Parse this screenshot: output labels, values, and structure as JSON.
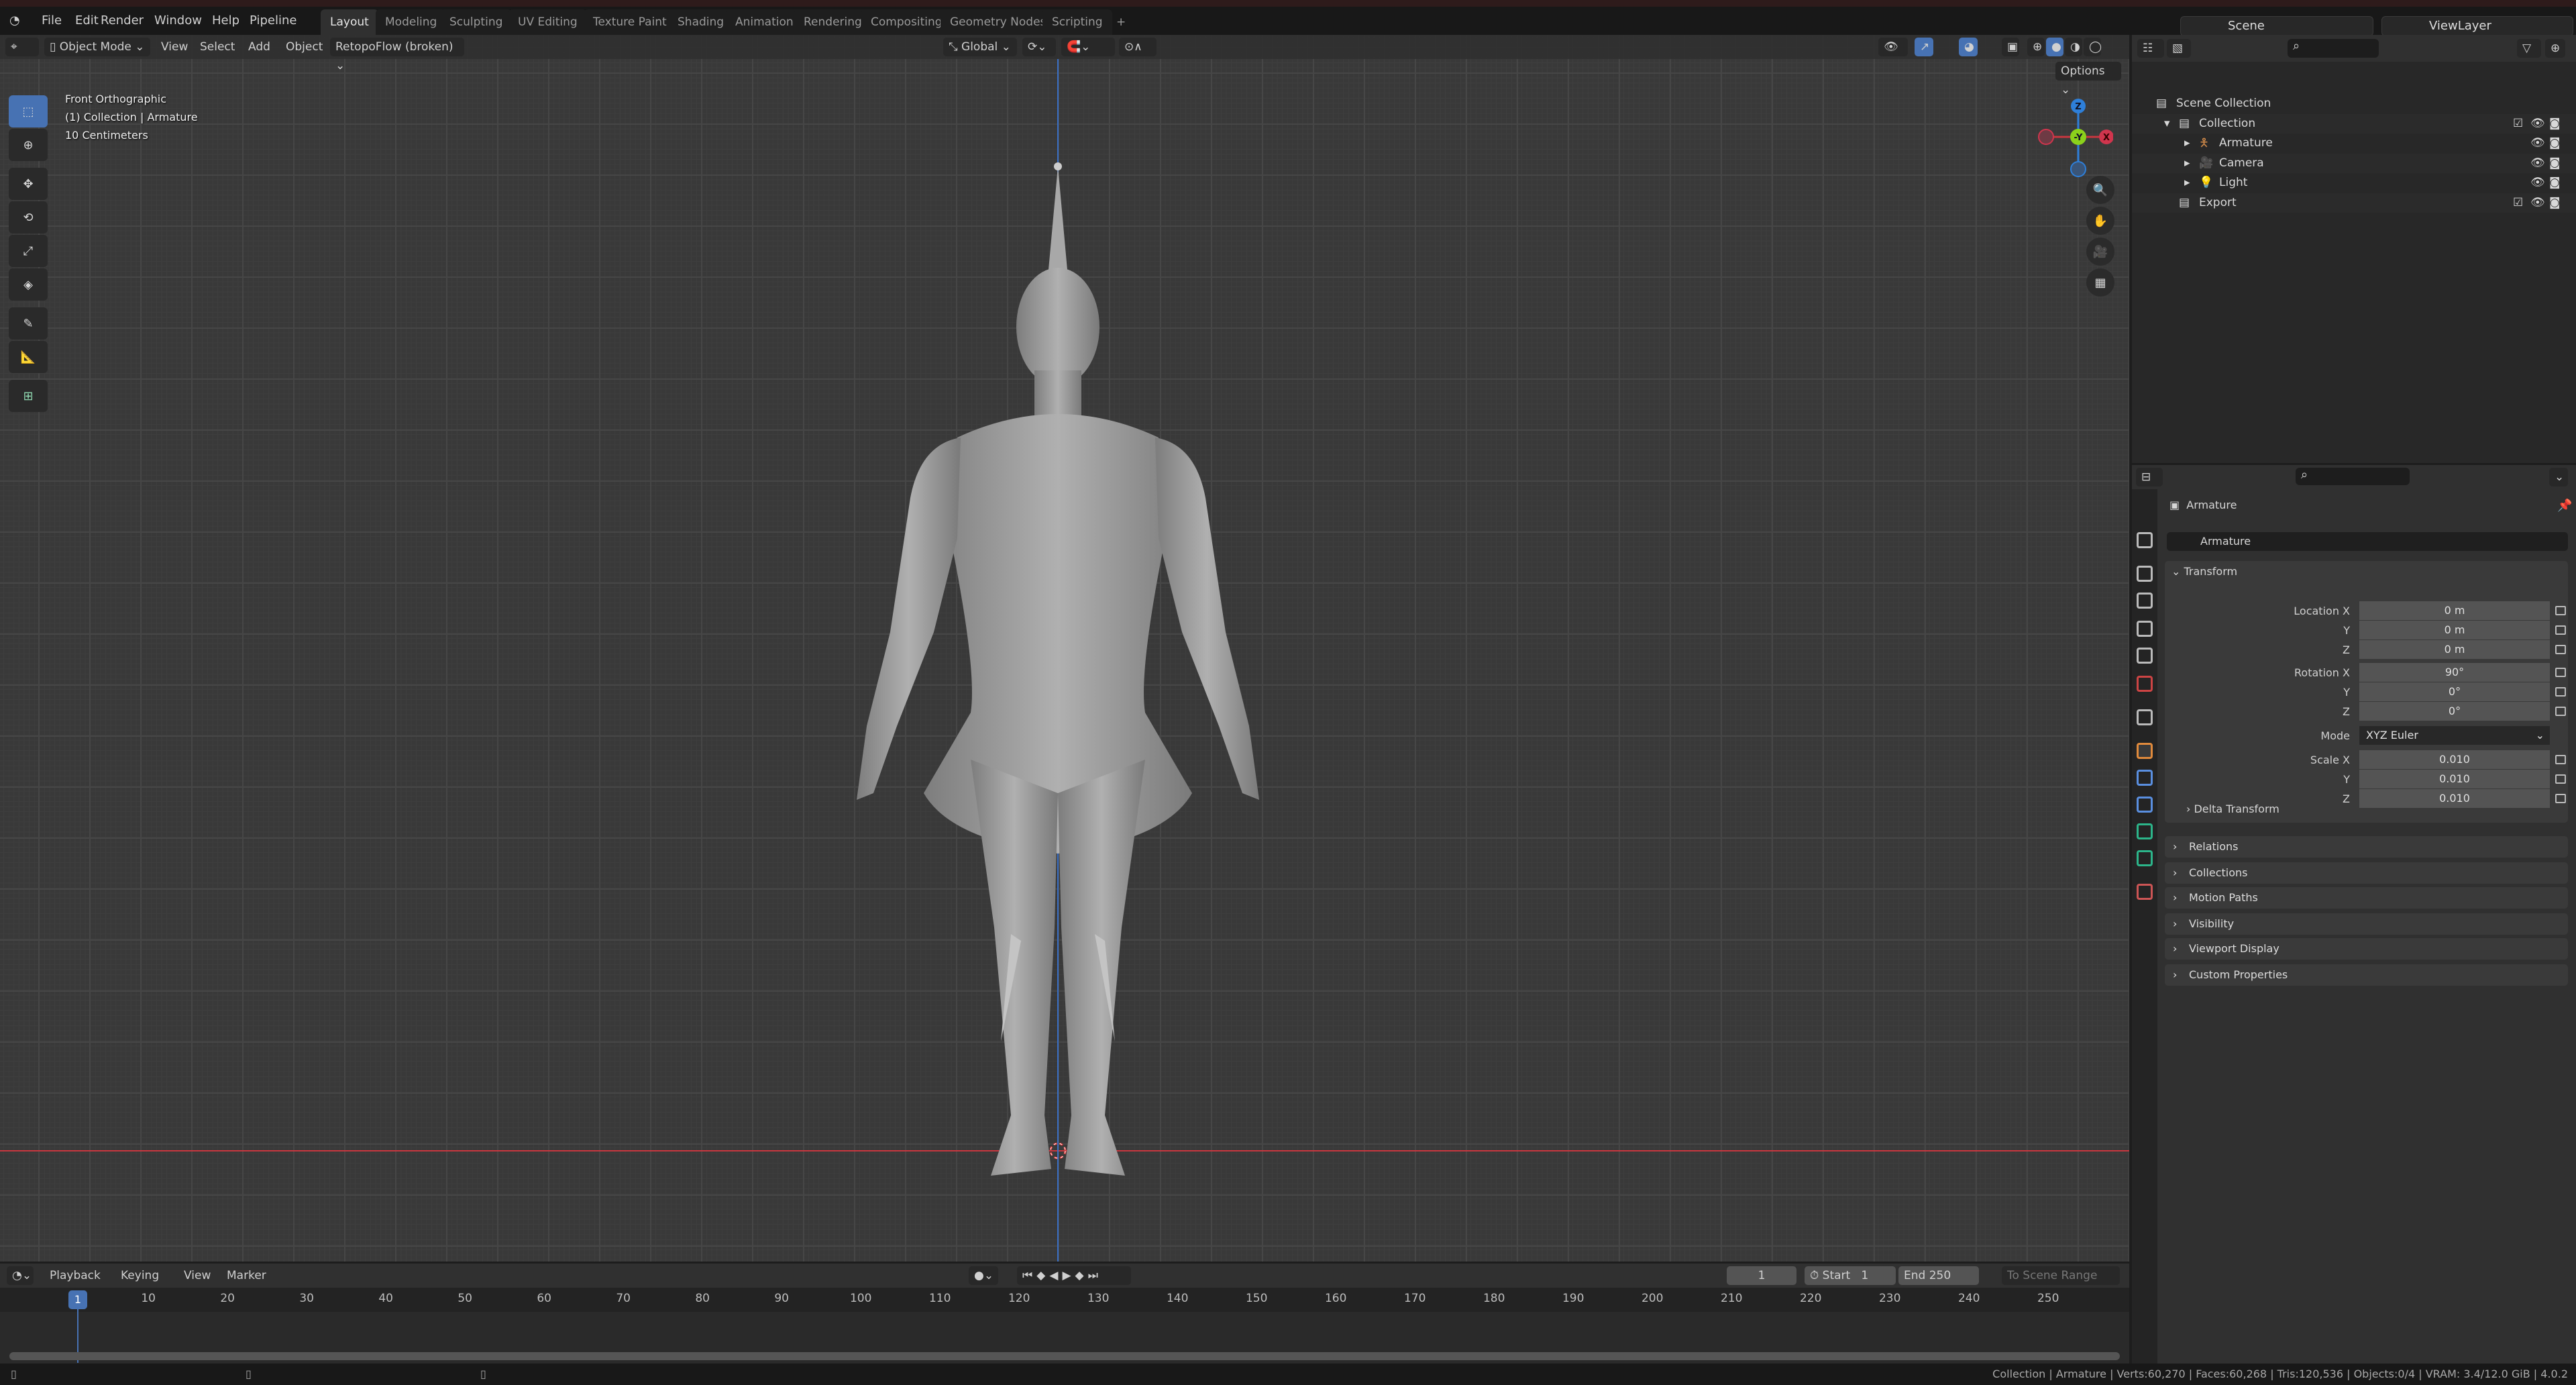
{
  "menubar": {
    "menus": [
      "File",
      "Edit",
      "Render",
      "Window",
      "Help",
      "Pipeline"
    ],
    "workspaces": [
      "Layout",
      "Modeling",
      "Sculpting",
      "UV Editing",
      "Texture Paint",
      "Shading",
      "Animation",
      "Rendering",
      "Compositing",
      "Geometry Nodes",
      "Scripting"
    ],
    "active_workspace": "Layout",
    "add_workspace": "+",
    "scene": "Scene",
    "view_layer": "ViewLayer"
  },
  "viewport": {
    "mode": "Object Mode",
    "menus": [
      "View",
      "Select",
      "Add",
      "Object"
    ],
    "addon_menu": "RetopoFlow (broken)",
    "orientation": "Global",
    "options": "Options",
    "overlay_lines": [
      "Front Orthographic",
      "(1) Collection | Armature",
      "10 Centimeters"
    ],
    "gizmo": {
      "z": "Z",
      "y": "-Y",
      "x": "X",
      "colors": {
        "x": "#d0354d",
        "y": "#8bd11b",
        "z": "#2e7fd9"
      }
    },
    "shading": "solid",
    "axis_colors": {
      "x_line": "#c9373f",
      "z_line": "#3a6fc4"
    }
  },
  "outliner": {
    "rows": [
      {
        "label": "Scene Collection",
        "icon": "collection-icon"
      },
      {
        "label": "Collection",
        "icon": "collection-icon",
        "checked": true
      },
      {
        "label": "Armature",
        "icon": "armature-icon"
      },
      {
        "label": "Camera",
        "icon": "camera-icon"
      },
      {
        "label": "Light",
        "icon": "light-icon"
      },
      {
        "label": "Export",
        "icon": "collection-icon",
        "checked": true
      }
    ]
  },
  "properties": {
    "context": "Armature",
    "object_name": "Armature",
    "transform": {
      "title": "Transform",
      "rows": [
        {
          "label": "Location X",
          "value": "0 m"
        },
        {
          "label": "Y",
          "value": "0 m"
        },
        {
          "label": "Z",
          "value": "0 m"
        },
        {
          "label": "Rotation X",
          "value": "90°"
        },
        {
          "label": "Y",
          "value": "0°"
        },
        {
          "label": "Z",
          "value": "0°"
        },
        {
          "label": "Mode",
          "value": "XYZ Euler"
        },
        {
          "label": "Scale X",
          "value": "0.010"
        },
        {
          "label": "Y",
          "value": "0.010"
        },
        {
          "label": "Z",
          "value": "0.010"
        }
      ],
      "delta": "Delta Transform"
    },
    "panels": [
      "Relations",
      "Collections",
      "Motion Paths",
      "Visibility",
      "Viewport Display",
      "Custom Properties"
    ]
  },
  "timeline": {
    "menus": [
      "Playback",
      "Keying",
      "View",
      "Marker"
    ],
    "current_frame": "1",
    "start_label": "Start",
    "start": "1",
    "end_label": "End",
    "end": "250",
    "scene_range": "To Scene Range",
    "ticks": [
      "10",
      "20",
      "30",
      "40",
      "50",
      "60",
      "70",
      "80",
      "90",
      "100",
      "110",
      "120",
      "130",
      "140",
      "150",
      "160",
      "170",
      "180",
      "190",
      "200",
      "210",
      "220",
      "230",
      "240",
      "250"
    ],
    "playhead": "1"
  },
  "statusbar": {
    "text": "Collection | Armature | Verts:60,270 | Faces:60,268 | Tris:120,536 | Objects:0/4 | VRAM: 3.4/12.0 GiB | 4.0.2"
  }
}
